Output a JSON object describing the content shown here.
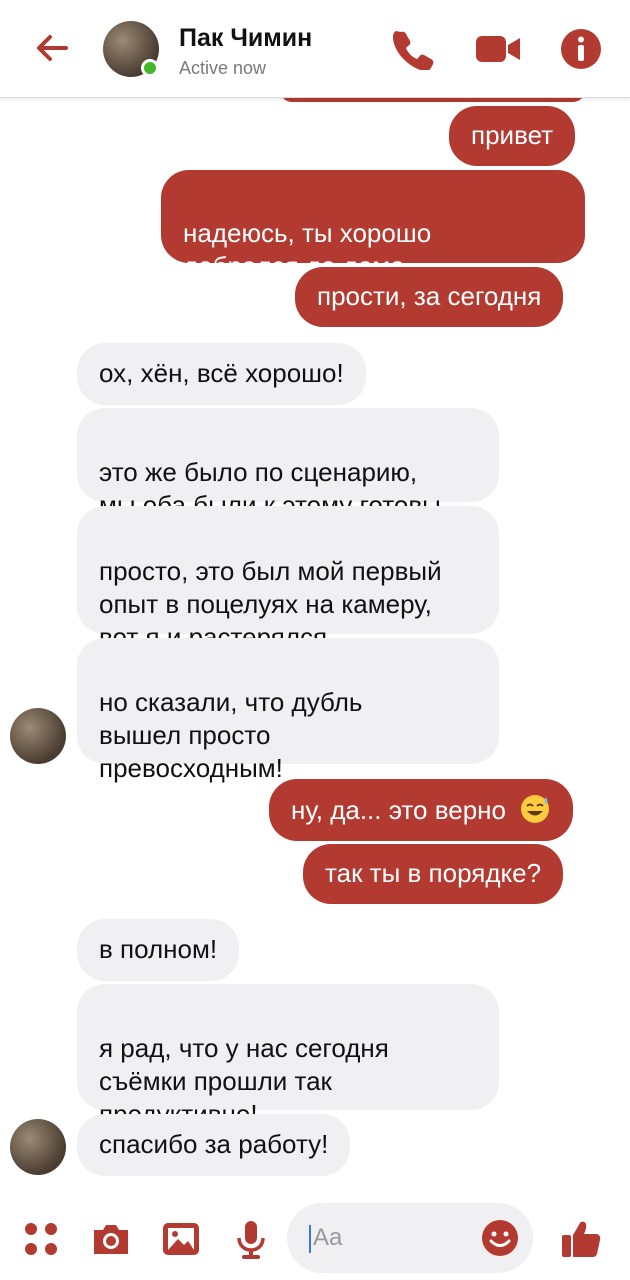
{
  "header": {
    "contact_name": "Пак Чимин",
    "status": "Active now"
  },
  "theme": {
    "accent": "#b33a30",
    "incoming_bg": "#f0eff2",
    "online": "#42b72a"
  },
  "messages": [
    {
      "from": "me",
      "text": "привет"
    },
    {
      "from": "me",
      "text": "надеюсь, ты хорошо\nдобрался до дома"
    },
    {
      "from": "me",
      "text": "прости, за сегодня"
    },
    {
      "from": "them",
      "text": "ох, хён, всё хорошо!"
    },
    {
      "from": "them",
      "text": "это же было по сценарию,\nмы оба были к этому готовы"
    },
    {
      "from": "them",
      "text": "просто, это был мой первый\nопыт в поцелуях на камеру,\nвот я и растерялся"
    },
    {
      "from": "them",
      "text": "но сказали, что дубль\nвышел просто\nпревосходным!"
    },
    {
      "from": "me",
      "text": "ну, да... это верно"
    },
    {
      "from": "me",
      "text": "так ты в порядке?"
    },
    {
      "from": "them",
      "text": "в полном!"
    },
    {
      "from": "them",
      "text": "я рад, что у нас сегодня\nсъёмки прошли так\nпродуктивно!"
    },
    {
      "from": "them",
      "text": "спасибо за работу!"
    }
  ],
  "composer": {
    "placeholder": "Aa"
  }
}
